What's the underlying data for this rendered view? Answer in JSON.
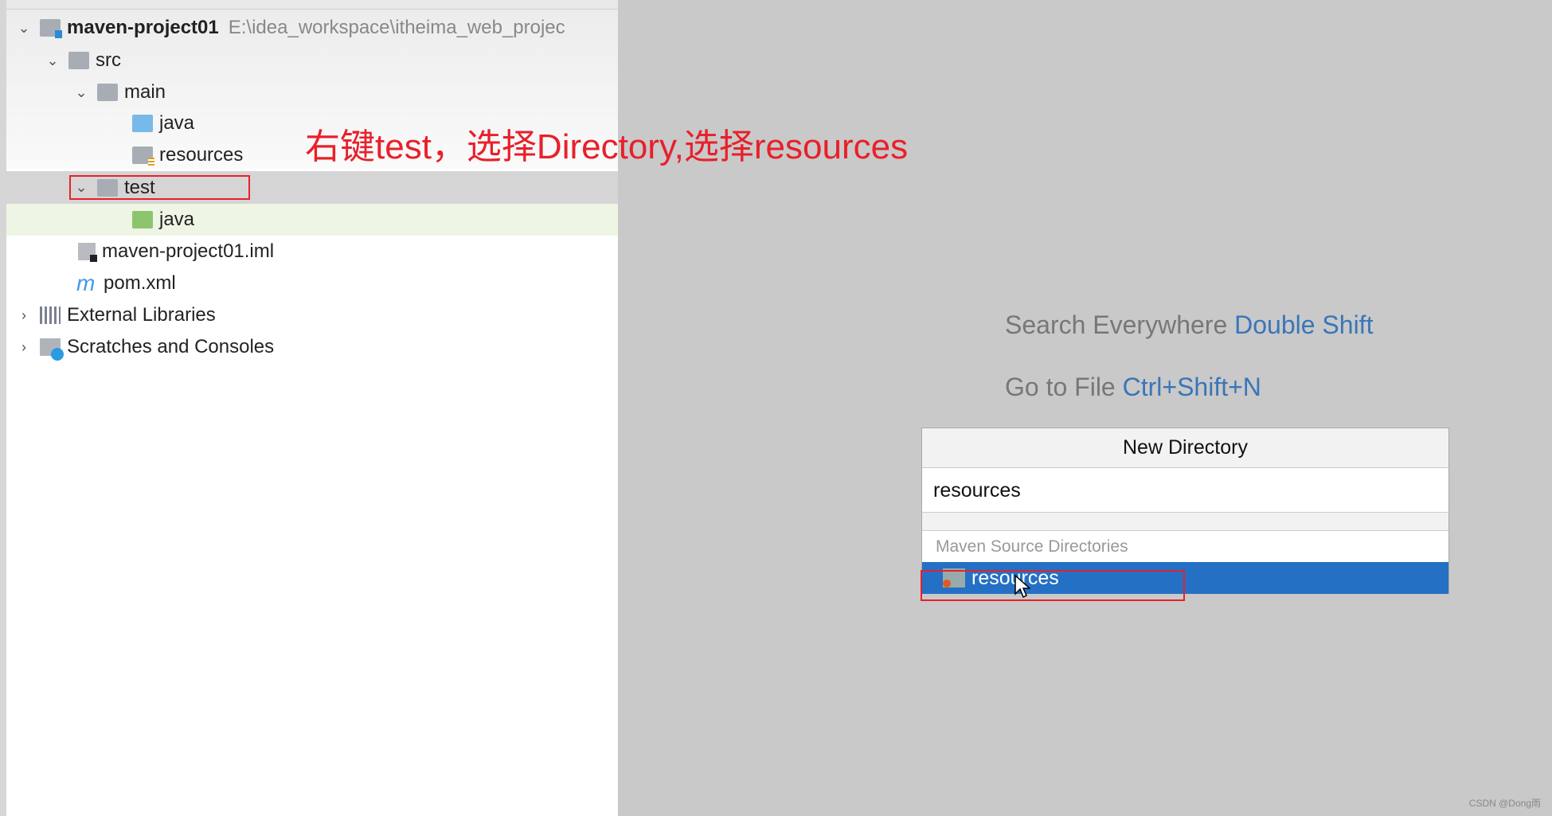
{
  "tree": [
    {
      "label": "maven-project01",
      "path": "E:\\idea_workspace\\itheima_web_projec",
      "icon": "module-folder-icon",
      "expanded": true
    },
    {
      "label": "src",
      "icon": "folder-icon",
      "expanded": true
    },
    {
      "label": "main",
      "icon": "folder-icon",
      "expanded": true
    },
    {
      "label": "java",
      "icon": "source-folder-icon"
    },
    {
      "label": "resources",
      "icon": "resources-folder-icon"
    },
    {
      "label": "test",
      "icon": "folder-icon",
      "expanded": true,
      "selected": true
    },
    {
      "label": "java",
      "icon": "test-source-folder-icon"
    },
    {
      "label": "maven-project01.iml",
      "icon": "iml-file-icon"
    },
    {
      "label": "pom.xml",
      "icon": "maven-icon"
    },
    {
      "label": "External Libraries",
      "icon": "libraries-icon",
      "expanded": false
    },
    {
      "label": "Scratches and Consoles",
      "icon": "scratches-icon",
      "expanded": false
    }
  ],
  "annotation": "右键test，选择Directory,选择resources",
  "hints": {
    "search_label": "Search Everywhere",
    "search_key": "Double Shift",
    "goto_label": "Go to File",
    "goto_key": "Ctrl+Shift+N"
  },
  "dialog": {
    "title": "New Directory",
    "input_value": "resources",
    "group_label": "Maven Source Directories",
    "suggestion": "resources"
  },
  "watermark": "CSDN @Dong雨",
  "colors": {
    "annotation": "#e8202a",
    "selection": "#2470c4",
    "shortcut": "#3a75b8"
  }
}
